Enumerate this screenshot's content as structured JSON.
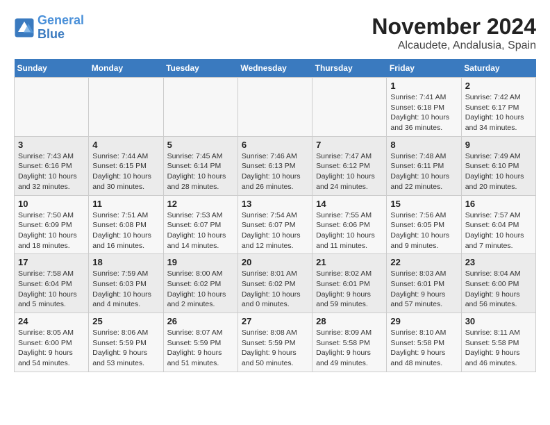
{
  "logo": {
    "line1": "General",
    "line2": "Blue"
  },
  "title": "November 2024",
  "subtitle": "Alcaudete, Andalusia, Spain",
  "days_of_week": [
    "Sunday",
    "Monday",
    "Tuesday",
    "Wednesday",
    "Thursday",
    "Friday",
    "Saturday"
  ],
  "weeks": [
    [
      {
        "num": "",
        "info": ""
      },
      {
        "num": "",
        "info": ""
      },
      {
        "num": "",
        "info": ""
      },
      {
        "num": "",
        "info": ""
      },
      {
        "num": "",
        "info": ""
      },
      {
        "num": "1",
        "info": "Sunrise: 7:41 AM\nSunset: 6:18 PM\nDaylight: 10 hours and 36 minutes."
      },
      {
        "num": "2",
        "info": "Sunrise: 7:42 AM\nSunset: 6:17 PM\nDaylight: 10 hours and 34 minutes."
      }
    ],
    [
      {
        "num": "3",
        "info": "Sunrise: 7:43 AM\nSunset: 6:16 PM\nDaylight: 10 hours and 32 minutes."
      },
      {
        "num": "4",
        "info": "Sunrise: 7:44 AM\nSunset: 6:15 PM\nDaylight: 10 hours and 30 minutes."
      },
      {
        "num": "5",
        "info": "Sunrise: 7:45 AM\nSunset: 6:14 PM\nDaylight: 10 hours and 28 minutes."
      },
      {
        "num": "6",
        "info": "Sunrise: 7:46 AM\nSunset: 6:13 PM\nDaylight: 10 hours and 26 minutes."
      },
      {
        "num": "7",
        "info": "Sunrise: 7:47 AM\nSunset: 6:12 PM\nDaylight: 10 hours and 24 minutes."
      },
      {
        "num": "8",
        "info": "Sunrise: 7:48 AM\nSunset: 6:11 PM\nDaylight: 10 hours and 22 minutes."
      },
      {
        "num": "9",
        "info": "Sunrise: 7:49 AM\nSunset: 6:10 PM\nDaylight: 10 hours and 20 minutes."
      }
    ],
    [
      {
        "num": "10",
        "info": "Sunrise: 7:50 AM\nSunset: 6:09 PM\nDaylight: 10 hours and 18 minutes."
      },
      {
        "num": "11",
        "info": "Sunrise: 7:51 AM\nSunset: 6:08 PM\nDaylight: 10 hours and 16 minutes."
      },
      {
        "num": "12",
        "info": "Sunrise: 7:53 AM\nSunset: 6:07 PM\nDaylight: 10 hours and 14 minutes."
      },
      {
        "num": "13",
        "info": "Sunrise: 7:54 AM\nSunset: 6:07 PM\nDaylight: 10 hours and 12 minutes."
      },
      {
        "num": "14",
        "info": "Sunrise: 7:55 AM\nSunset: 6:06 PM\nDaylight: 10 hours and 11 minutes."
      },
      {
        "num": "15",
        "info": "Sunrise: 7:56 AM\nSunset: 6:05 PM\nDaylight: 10 hours and 9 minutes."
      },
      {
        "num": "16",
        "info": "Sunrise: 7:57 AM\nSunset: 6:04 PM\nDaylight: 10 hours and 7 minutes."
      }
    ],
    [
      {
        "num": "17",
        "info": "Sunrise: 7:58 AM\nSunset: 6:04 PM\nDaylight: 10 hours and 5 minutes."
      },
      {
        "num": "18",
        "info": "Sunrise: 7:59 AM\nSunset: 6:03 PM\nDaylight: 10 hours and 4 minutes."
      },
      {
        "num": "19",
        "info": "Sunrise: 8:00 AM\nSunset: 6:02 PM\nDaylight: 10 hours and 2 minutes."
      },
      {
        "num": "20",
        "info": "Sunrise: 8:01 AM\nSunset: 6:02 PM\nDaylight: 10 hours and 0 minutes."
      },
      {
        "num": "21",
        "info": "Sunrise: 8:02 AM\nSunset: 6:01 PM\nDaylight: 9 hours and 59 minutes."
      },
      {
        "num": "22",
        "info": "Sunrise: 8:03 AM\nSunset: 6:01 PM\nDaylight: 9 hours and 57 minutes."
      },
      {
        "num": "23",
        "info": "Sunrise: 8:04 AM\nSunset: 6:00 PM\nDaylight: 9 hours and 56 minutes."
      }
    ],
    [
      {
        "num": "24",
        "info": "Sunrise: 8:05 AM\nSunset: 6:00 PM\nDaylight: 9 hours and 54 minutes."
      },
      {
        "num": "25",
        "info": "Sunrise: 8:06 AM\nSunset: 5:59 PM\nDaylight: 9 hours and 53 minutes."
      },
      {
        "num": "26",
        "info": "Sunrise: 8:07 AM\nSunset: 5:59 PM\nDaylight: 9 hours and 51 minutes."
      },
      {
        "num": "27",
        "info": "Sunrise: 8:08 AM\nSunset: 5:59 PM\nDaylight: 9 hours and 50 minutes."
      },
      {
        "num": "28",
        "info": "Sunrise: 8:09 AM\nSunset: 5:58 PM\nDaylight: 9 hours and 49 minutes."
      },
      {
        "num": "29",
        "info": "Sunrise: 8:10 AM\nSunset: 5:58 PM\nDaylight: 9 hours and 48 minutes."
      },
      {
        "num": "30",
        "info": "Sunrise: 8:11 AM\nSunset: 5:58 PM\nDaylight: 9 hours and 46 minutes."
      }
    ]
  ]
}
